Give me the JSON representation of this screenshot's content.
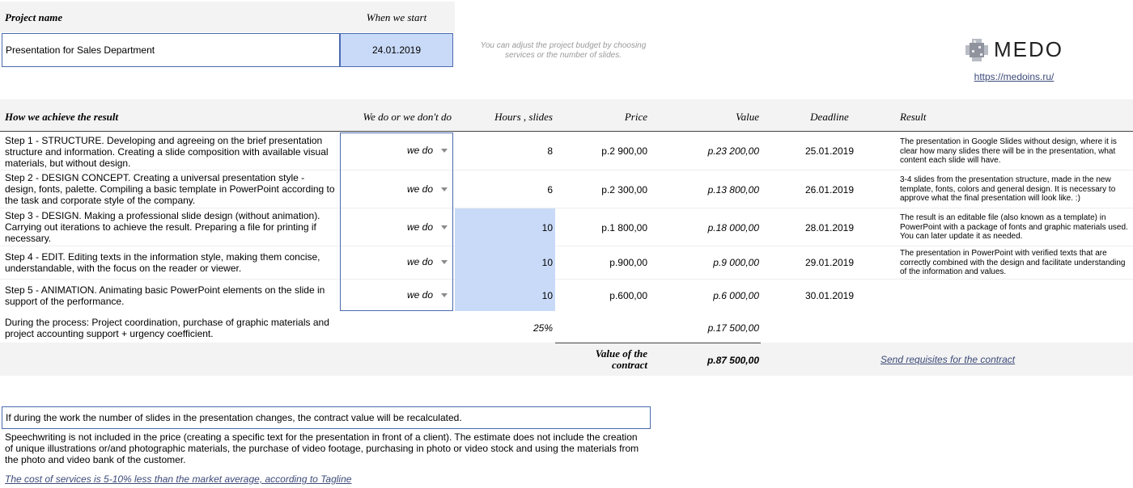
{
  "header": {
    "project_name_label": "Project name",
    "start_label": "When we start",
    "project_name_value": "Presentation for Sales Department",
    "start_date": "24.01.2019",
    "hint": "You can adjust the project budget by choosing services or the number of slides."
  },
  "brand": {
    "logo_text": "MEDO",
    "url": "https://medoins.ru/"
  },
  "table": {
    "headers": {
      "how": "How we achieve the result",
      "dodont": "We do or we don't do",
      "hours": "Hours , slides",
      "price": "Price",
      "value": "Value",
      "deadline": "Deadline",
      "result": "Result"
    },
    "rows": [
      {
        "step": "Step 1 - STRUCTURE. Developing and agreeing on the brief presentation structure and information. Creating a slide composition with available visual materials, but without design.",
        "choice": "we do",
        "hours": "8",
        "price": "p.2 900,00",
        "value": "p.23 200,00",
        "deadline": "25.01.2019",
        "result": "The presentation in Google Slides without design, where it is clear how many slides there will be in the presentation, what content each slide will have."
      },
      {
        "step": "Step 2 - DESIGN CONCEPT. Creating a universal presentation style - design, fonts, palette. Compiling a basic template in PowerPoint according to the task and corporate style of the company.",
        "choice": "we do",
        "hours": "6",
        "price": "p.2 300,00",
        "value": "p.13 800,00",
        "deadline": "26.01.2019",
        "result": "3-4 slides from the presentation structure, made in the new template, fonts, colors and general design. It is necessary to approve what the final presentation will look like. :)"
      },
      {
        "step": "Step 3 - DESIGN. Making a professional slide design (without animation). Carrying out iterations to achieve the result. Preparing a file for printing if necessary.",
        "choice": "we do",
        "hours": "10",
        "price": "p.1 800,00",
        "value": "p.18 000,00",
        "deadline": "28.01.2019",
        "result": "The result is an editable file (also known as a template) in PowerPoint with a package of fonts and graphic materials used. You can later update it as needed."
      },
      {
        "step": "Step 4 - EDIT. Editing texts in the information style, making them concise, understandable, with the focus on the reader or viewer.",
        "choice": "we do",
        "hours": "10",
        "price": "p.900,00",
        "value": "p.9 000,00",
        "deadline": "29.01.2019",
        "result": "The presentation in PowerPoint with verified texts that are correctly combined with the design and facilitate understanding of the information and values."
      },
      {
        "step": "Step 5 - ANIMATION. Animating basic PowerPoint elements on the slide in support of the performance.",
        "choice": "we do",
        "hours": "10",
        "price": "p.600,00",
        "value": "p.6 000,00",
        "deadline": "30.01.2019",
        "result": ""
      }
    ],
    "process": {
      "text": "During the process: Project coordination, purchase of graphic materials and project accounting support + urgency coefficient.",
      "percent": "25%",
      "value": "p.17 500,00"
    },
    "total": {
      "label": "Value of the contract",
      "value": "p.87 500,00",
      "requisites_link": "Send requisites for the contract"
    }
  },
  "notes": {
    "recalc": "If during the work the number of slides in the presentation changes, the contract value will be recalculated.",
    "speechwriting": "Speechwriting is not included in the price (creating a specific text for the presentation in front of a client). The estimate does not include the creation of unique illustrations or/and photographic materials, the purchase of video footage, purchasing in photo or video stock and using the materials from the photo and video bank of the customer.",
    "cost_link": "The cost of services is 5-10% less than the market average, according to Tagline"
  }
}
